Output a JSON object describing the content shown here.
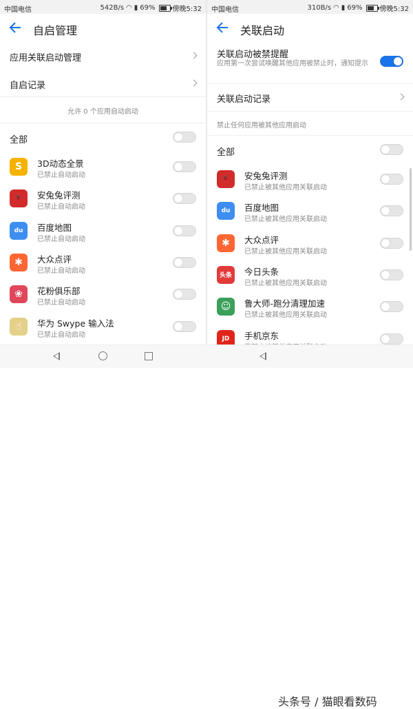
{
  "colors": {
    "accent": "#1a73e8",
    "toggle_off": "#e6e6e6"
  },
  "left": {
    "status": {
      "carrier": "中国电信",
      "speed": "542B/s",
      "battery": "69%",
      "time": "傍晚5:32"
    },
    "title": "自启管理",
    "menu": [
      {
        "label": "应用关联启动管理"
      },
      {
        "label": "自启记录"
      }
    ],
    "info": "允许 0 个应用自动启动",
    "all_label": "全部",
    "apps": [
      {
        "name": "3D动态全景",
        "status": "已禁止自动启动",
        "icon": "3d-panorama-app-icon",
        "color": "#f5b300",
        "glyph": "S"
      },
      {
        "name": "安兔兔评测",
        "status": "已禁止自动启动",
        "icon": "antutu-app-icon",
        "color": "#d22b2b",
        "glyph": "🐞"
      },
      {
        "name": "百度地图",
        "status": "已禁止自动启动",
        "icon": "baidu-map-app-icon",
        "color": "#3d8ef0",
        "glyph": "du"
      },
      {
        "name": "大众点评",
        "status": "已禁止自动启动",
        "icon": "dianping-app-icon",
        "color": "#ff6633",
        "glyph": "✱"
      },
      {
        "name": "花粉俱乐部",
        "status": "已禁止自动启动",
        "icon": "huafen-club-app-icon",
        "color": "#e0475a",
        "glyph": "❀"
      },
      {
        "name": "华为 Swype 输入法",
        "status": "已禁止自动启动",
        "icon": "swype-app-icon",
        "color": "#e5d08a",
        "glyph": "☝"
      }
    ]
  },
  "right": {
    "status": {
      "carrier": "中国电信",
      "speed": "310B/s",
      "battery": "69%",
      "time": "傍晚5:32"
    },
    "title": "关联启动",
    "reminder": {
      "label": "关联启动被禁提醒",
      "desc": "应用第一次尝试唤醒其他应用被禁止时，通知提示"
    },
    "records_label": "关联启动记录",
    "info": "禁止任何应用被其他应用启动",
    "all_label": "全部",
    "apps": [
      {
        "name": "安兔兔评测",
        "status": "已禁止被其他应用关联启动",
        "icon": "antutu-app-icon",
        "color": "#d22b2b",
        "glyph": "🐞"
      },
      {
        "name": "百度地图",
        "status": "已禁止被其他应用关联启动",
        "icon": "baidu-map-app-icon",
        "color": "#3d8ef0",
        "glyph": "du"
      },
      {
        "name": "大众点评",
        "status": "已禁止被其他应用关联启动",
        "icon": "dianping-app-icon",
        "color": "#ff6633",
        "glyph": "✱"
      },
      {
        "name": "今日头条",
        "status": "已禁止被其他应用关联启动",
        "icon": "toutiao-app-icon",
        "color": "#e33a3a",
        "glyph": "头条"
      },
      {
        "name": "鲁大师-跑分清理加速",
        "status": "已禁止被其他应用关联启动",
        "icon": "ludashi-app-icon",
        "color": "#3aa05a",
        "glyph": "☺"
      },
      {
        "name": "手机京东",
        "status": "已禁止被其他应用关联启动",
        "icon": "jd-app-icon",
        "color": "#e1251b",
        "glyph": "JD"
      }
    ]
  },
  "watermark": "头条号 / 猫眼看数码"
}
